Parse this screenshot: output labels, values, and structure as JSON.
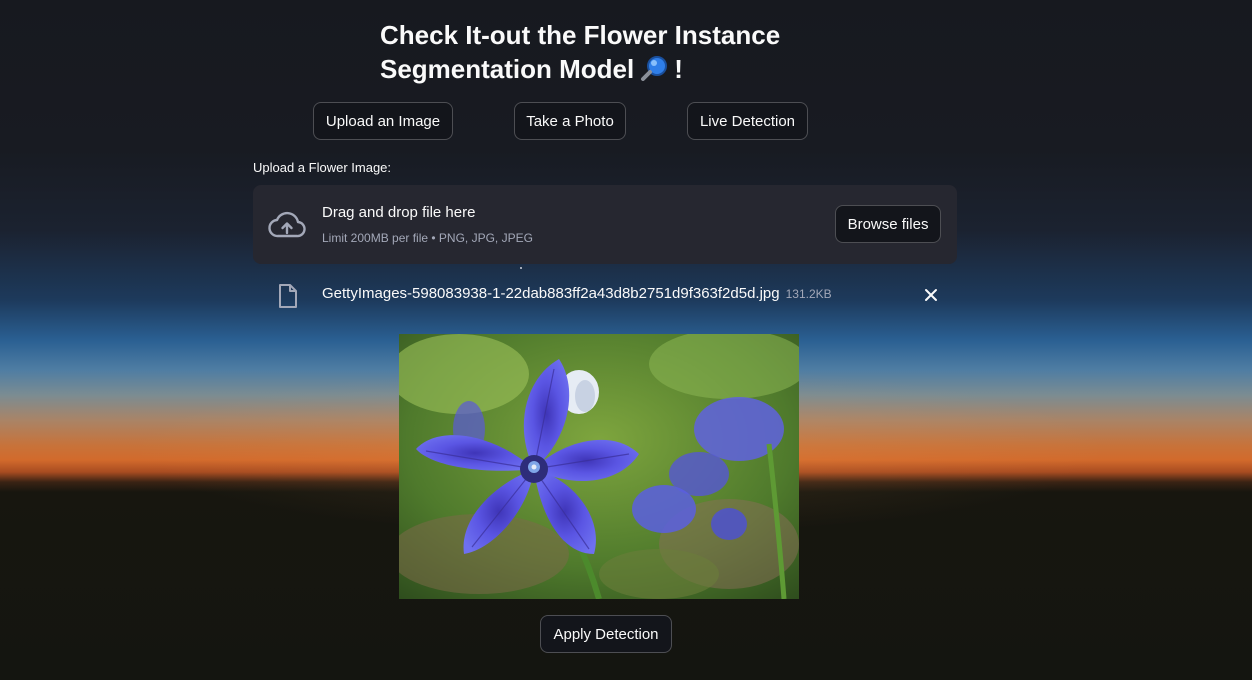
{
  "header": {
    "title_line1": "Check It-out the Flower Instance",
    "title_line2": "Segmentation Model",
    "title_icon": "magnifier-icon",
    "title_suffix": "!"
  },
  "mode_buttons": {
    "upload": "Upload an Image",
    "photo": "Take a Photo",
    "live": "Live Detection"
  },
  "uploader": {
    "label": "Upload a Flower Image:",
    "drop_title": "Drag and drop file here",
    "limit_text": "Limit 200MB per file • PNG, JPG, JPEG",
    "browse_label": "Browse files",
    "icon": "cloud-upload-icon"
  },
  "uploaded_file": {
    "name": "GettyImages-598083938-1-22dab883ff2a43d8b2751d9f363f2d5d.jpg",
    "size": "131.2KB",
    "icon": "file-icon",
    "remove_icon": "close-icon"
  },
  "preview": {
    "subject": "blue balloon flower photo"
  },
  "actions": {
    "apply_label": "Apply Detection"
  },
  "colors": {
    "background": "#15171c",
    "dropzone": "#262730",
    "button_bg": "#13151b",
    "text": "#fafafa",
    "muted_text": "#a3a8b8",
    "flower": "#5b4fe0"
  }
}
